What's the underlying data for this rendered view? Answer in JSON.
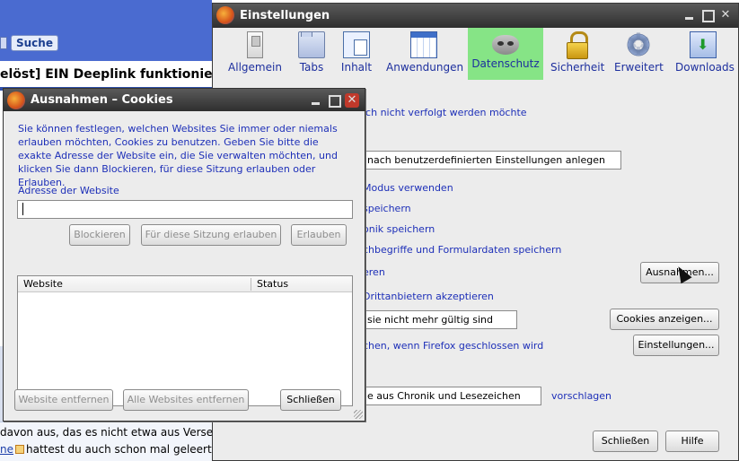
{
  "background_page": {
    "search_button": "Suche",
    "thread_title": "elöst] EIN Deeplink funktionie",
    "post_line1": "davon aus, das es nicht etwa aus Versel",
    "post_line2_link": "ne",
    "post_line2_rest": "hattest du auch schon mal geleert?"
  },
  "main_window": {
    "title": "Einstellungen",
    "panes": [
      {
        "label": "Allgemein",
        "icon": "switch-icon"
      },
      {
        "label": "Tabs",
        "icon": "tabs-icon"
      },
      {
        "label": "Inhalt",
        "icon": "content-icon"
      },
      {
        "label": "Anwendungen",
        "icon": "applications-icon"
      },
      {
        "label": "Datenschutz",
        "icon": "mask-icon"
      },
      {
        "label": "Sicherheit",
        "icon": "lock-icon"
      },
      {
        "label": "Erweitert",
        "icon": "gear-icon"
      },
      {
        "label": "Downloads",
        "icon": "download-icon"
      }
    ],
    "active_pane": "Datenschutz",
    "tracking_text": "ich nicht verfolgt werden möchte",
    "history_mode_value": "nach benutzerdefinierten Einstellungen anlegen",
    "private_mode_text": "Modus verwenden",
    "save_text": "speichern",
    "history_text": "onik speichern",
    "search_form_text": "chbegriffe und Formulardaten speichern",
    "cookies_text": "eren",
    "third_party_text": "Drittanbietern akzeptieren",
    "keep_until_value": "sie nicht mehr gültig sind",
    "clear_on_close_text": "chen, wenn Firefox geschlossen wird",
    "suggest_value": "e aus Chronik und Lesezeichen",
    "suggest_label": "vorschlagen",
    "exceptions_button": "Ausnahmen...",
    "show_cookies_button": "Cookies anzeigen...",
    "settings_button": "Einstellungen...",
    "close_button": "Schließen",
    "help_button": "Hilfe"
  },
  "dialog": {
    "title": "Ausnahmen – Cookies",
    "description": "Sie können festlegen, welchen Websites Sie immer oder niemals erlauben möchten, Cookies zu benutzen. Geben Sie bitte die exakte Adresse der Website ein, die Sie verwalten möchten, und klicken Sie dann Blockieren, für diese Sitzung erlauben oder Erlauben.",
    "address_label": "Adresse der Website",
    "address_value": "",
    "block_button": "Blockieren",
    "session_button": "Für diese Sitzung erlauben",
    "allow_button": "Erlauben",
    "columns": [
      "Website",
      "Status"
    ],
    "remove_button": "Website entfernen",
    "remove_all_button": "Alle Websites entfernen",
    "close_button": "Schließen"
  }
}
